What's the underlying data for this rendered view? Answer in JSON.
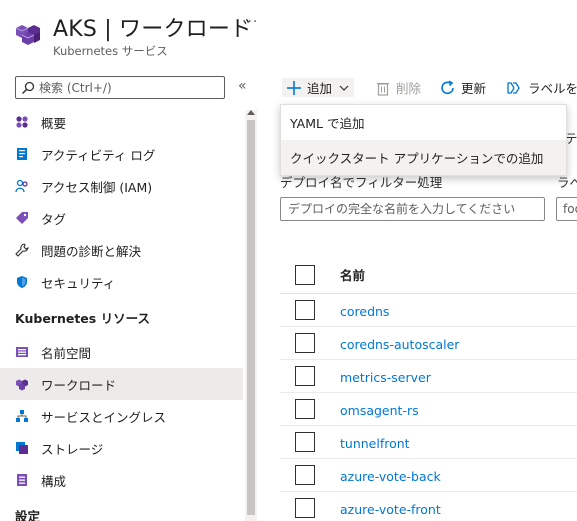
{
  "header": {
    "title": "AKS | ワークロード",
    "subtitle": "Kubernetes サービス",
    "more": "···"
  },
  "sidebar": {
    "search_placeholder": "検索 (Ctrl+/)",
    "collapse": "«",
    "items": [
      {
        "label": "概要",
        "icon": "overview-icon"
      },
      {
        "label": "アクティビティ ログ",
        "icon": "activity-log-icon"
      },
      {
        "label": "アクセス制御 (IAM)",
        "icon": "iam-icon"
      },
      {
        "label": "タグ",
        "icon": "tag-icon"
      },
      {
        "label": "問題の診断と解決",
        "icon": "wrench-icon"
      },
      {
        "label": "セキュリティ",
        "icon": "shield-icon"
      }
    ],
    "section": "Kubernetes リソース",
    "resources": [
      {
        "label": "名前空間",
        "icon": "namespace-icon"
      },
      {
        "label": "ワークロード",
        "icon": "workload-icon",
        "active": true
      },
      {
        "label": "サービスとイングレス",
        "icon": "services-icon"
      },
      {
        "label": "ストレージ",
        "icon": "storage-icon"
      },
      {
        "label": "構成",
        "icon": "config-icon"
      }
    ],
    "section2_partial": "設定"
  },
  "toolbar": {
    "add": "追加",
    "delete": "削除",
    "refresh": "更新",
    "labels": "ラベルを"
  },
  "add_menu": {
    "items": [
      "YAML で追加",
      "クイックスタート アプリケーションでの追加"
    ]
  },
  "filter": {
    "desc_fragment": "テ",
    "label": "デプロイ名でフィルター処理",
    "placeholder": "デプロイの完全な名前を入力してください",
    "label2": "ラベ",
    "placeholder2": "foo"
  },
  "table": {
    "header_name": "名前",
    "rows": [
      "coredns",
      "coredns-autoscaler",
      "metrics-server",
      "omsagent-rs",
      "tunnelfront",
      "azure-vote-back",
      "azure-vote-front"
    ]
  },
  "colors": {
    "accent": "#0078d4",
    "aks_purple": "#5c2d91"
  }
}
